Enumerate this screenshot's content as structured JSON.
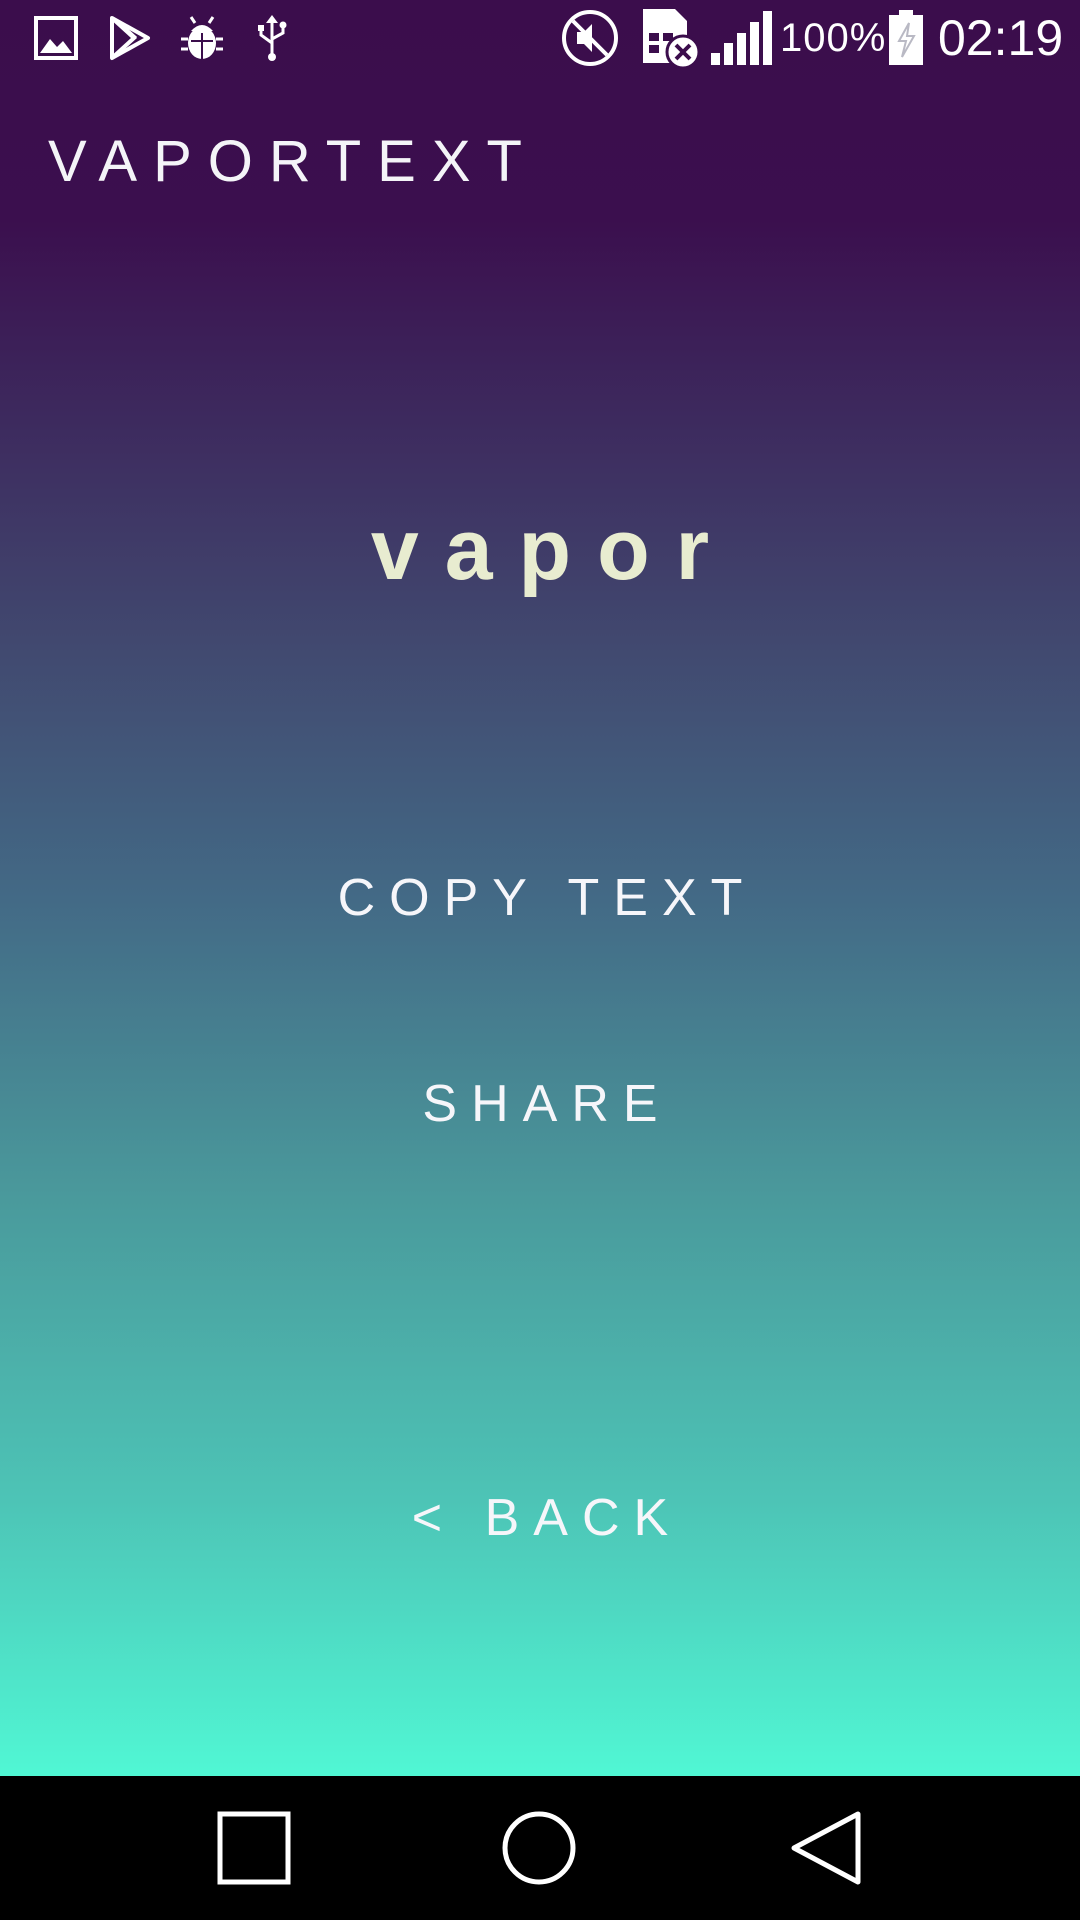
{
  "status_bar": {
    "left_icons": [
      "image-icon",
      "play-store-icon",
      "bug-icon",
      "usb-icon"
    ],
    "right_icons": [
      "mute-icon",
      "no-sim-icon",
      "signal-icon",
      "battery-charging-icon"
    ],
    "battery_percent": "100%",
    "time": "02:19"
  },
  "app": {
    "title": "VAPORTEXT",
    "output_text": "vapor",
    "copy_label": "COPY TEXT",
    "share_label": "SHARE",
    "back_label": "< BACK"
  },
  "colors": {
    "gradient_top": "#3b0d4c",
    "gradient_bottom": "#50f7d4",
    "output_text": "#e8ecd0",
    "label_text": "#f6f6fa"
  },
  "nav_bar": {
    "icons": [
      "recents-icon",
      "home-icon",
      "back-triangle-icon"
    ]
  }
}
